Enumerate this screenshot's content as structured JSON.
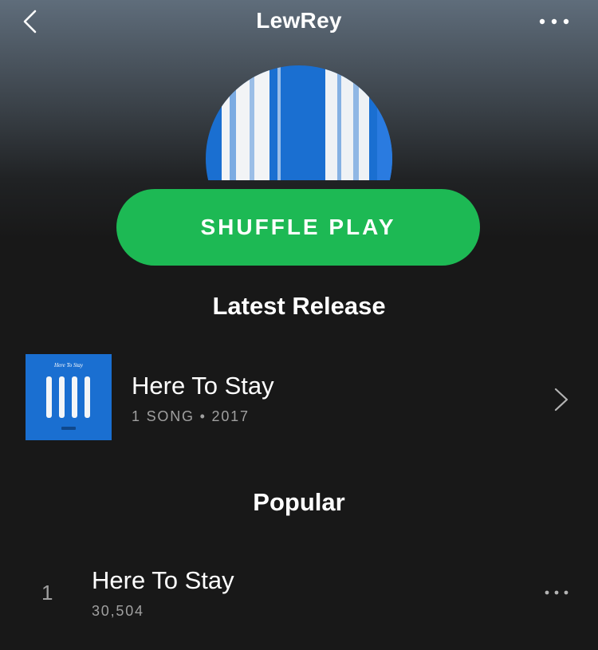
{
  "header": {
    "title": "LewRey",
    "back_icon": "chevron-left-icon",
    "more_icon": "more-horizontal-icon"
  },
  "actions": {
    "shuffle_label": "SHUFFLE PLAY"
  },
  "latest_release": {
    "section_title": "Latest Release",
    "name": "Here To Stay",
    "meta": "1 SONG • 2017",
    "art_caption": "Here To Stay",
    "chevron_icon": "chevron-right-icon"
  },
  "popular": {
    "section_title": "Popular",
    "tracks": [
      {
        "number": "1",
        "name": "Here To Stay",
        "plays": "30,504"
      }
    ]
  },
  "colors": {
    "accent": "#1db954",
    "background": "#181818",
    "secondary_text": "#a0a0a0",
    "art_blue": "#1a6fd1"
  }
}
